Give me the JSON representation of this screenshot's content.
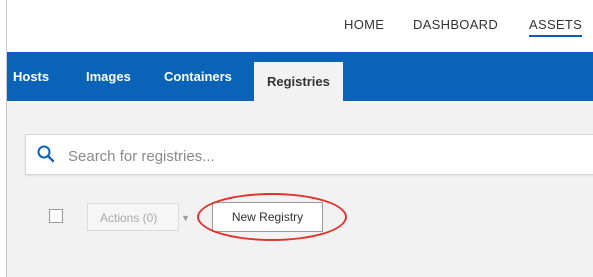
{
  "top_nav": {
    "items": [
      {
        "label": "HOME",
        "active": false
      },
      {
        "label": "DASHBOARD",
        "active": false
      },
      {
        "label": "ASSETS",
        "active": true
      }
    ]
  },
  "tabs": [
    {
      "label": "Hosts",
      "active": false
    },
    {
      "label": "Images",
      "active": false
    },
    {
      "label": "Containers",
      "active": false
    },
    {
      "label": "Registries",
      "active": true
    }
  ],
  "search": {
    "placeholder": "Search for registries...",
    "value": ""
  },
  "toolbar": {
    "actions_label": "Actions (0)",
    "new_registry_label": "New Registry"
  },
  "icons": {
    "search": "search-icon",
    "dropdown": "chevron-down-icon"
  },
  "colors": {
    "tabbar_bg": "#0b63b8",
    "content_bg": "#f2f2f2",
    "highlight": "#e0332b"
  }
}
